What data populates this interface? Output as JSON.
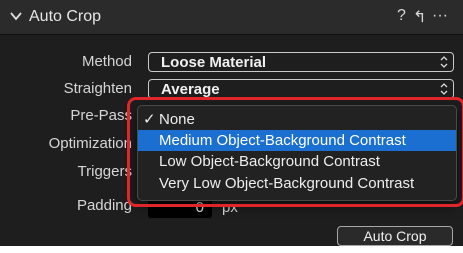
{
  "header": {
    "title": "Auto Crop",
    "help": "?",
    "reset": "↰",
    "more": "···"
  },
  "fields": {
    "method_label": "Method",
    "method_value": "Loose Material",
    "straighten_label": "Straighten",
    "straighten_value": "Average",
    "prepass_label": "Pre-Pass",
    "optimization_label": "Optimization",
    "triggers_label": "Triggers",
    "padding_label": "Padding",
    "padding_value": "0",
    "padding_unit": "px"
  },
  "menu": {
    "items": [
      {
        "label": "None",
        "checked": true
      },
      {
        "label": "Medium Object-Background Contrast",
        "selected": true
      },
      {
        "label": "Low Object-Background Contrast"
      },
      {
        "label": "Very Low Object-Background Contrast"
      }
    ],
    "check_mark": "✓"
  },
  "button": {
    "auto_crop_label": "Auto Crop"
  },
  "colors": {
    "highlight": "#1a6fd1",
    "annotation": "#e0252b"
  }
}
